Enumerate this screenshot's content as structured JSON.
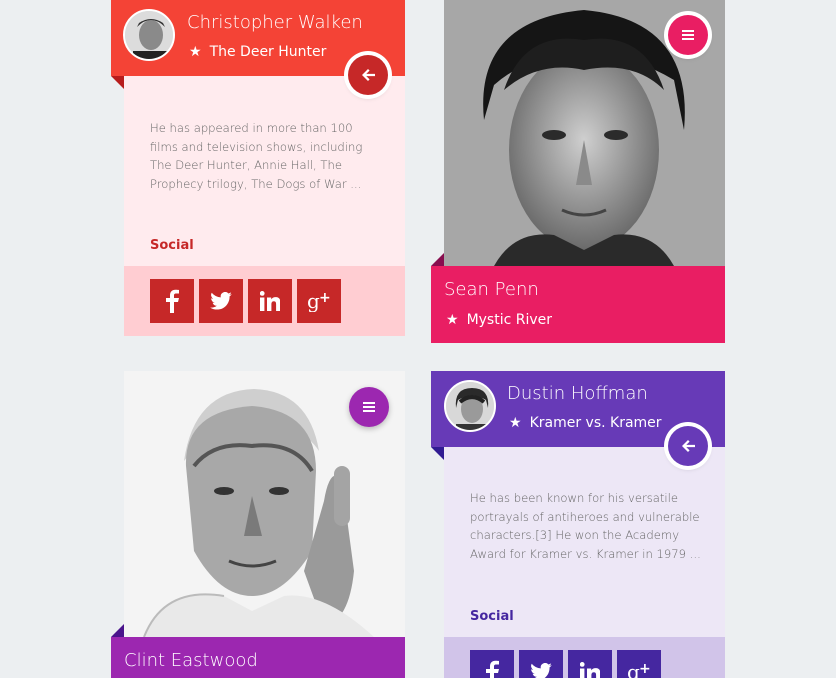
{
  "cards": {
    "walken": {
      "name": "Christopher Walken",
      "movie": "The Deer Hunter",
      "description": "He has appeared in more than 100 films and television shows, including The Deer Hunter, Annie Hall, The Prophecy trilogy, The Dogs of War ...",
      "social_label": "Social",
      "colors": {
        "accent": "#f44336",
        "dark": "#c62828",
        "body": "#ffebee",
        "footer": "#ffcdd2",
        "fold": "#b71c1c"
      },
      "action_icon": "arrow-left-icon"
    },
    "penn": {
      "name": "Sean Penn",
      "movie": "Mystic River",
      "colors": {
        "accent": "#e91e63",
        "fold": "#880e4f"
      },
      "action_icon": "menu-icon"
    },
    "eastwood": {
      "name": "Clint Eastwood",
      "colors": {
        "accent": "#9c27b0",
        "fold": "#4a148c"
      },
      "action_icon": "menu-icon"
    },
    "hoffman": {
      "name": "Dustin Hoffman",
      "movie": "Kramer vs. Kramer",
      "description": "He has been known for his versatile portrayals of antiheroes and vulnerable characters.[3] He won the Academy Award for Kramer vs. Kramer in 1979 ...",
      "social_label": "Social",
      "colors": {
        "accent": "#673ab7",
        "dark": "#4527a0",
        "body": "#ede7f6",
        "footer": "#d1c4e9",
        "fold": "#311b92"
      },
      "action_icon": "arrow-left-icon"
    }
  },
  "social_icons": [
    "facebook-icon",
    "twitter-icon",
    "linkedin-icon",
    "google-plus-icon"
  ],
  "social_glyphs": {
    "facebook": "f",
    "twitter": "t",
    "linkedin": "in",
    "google_plus": "g+"
  }
}
